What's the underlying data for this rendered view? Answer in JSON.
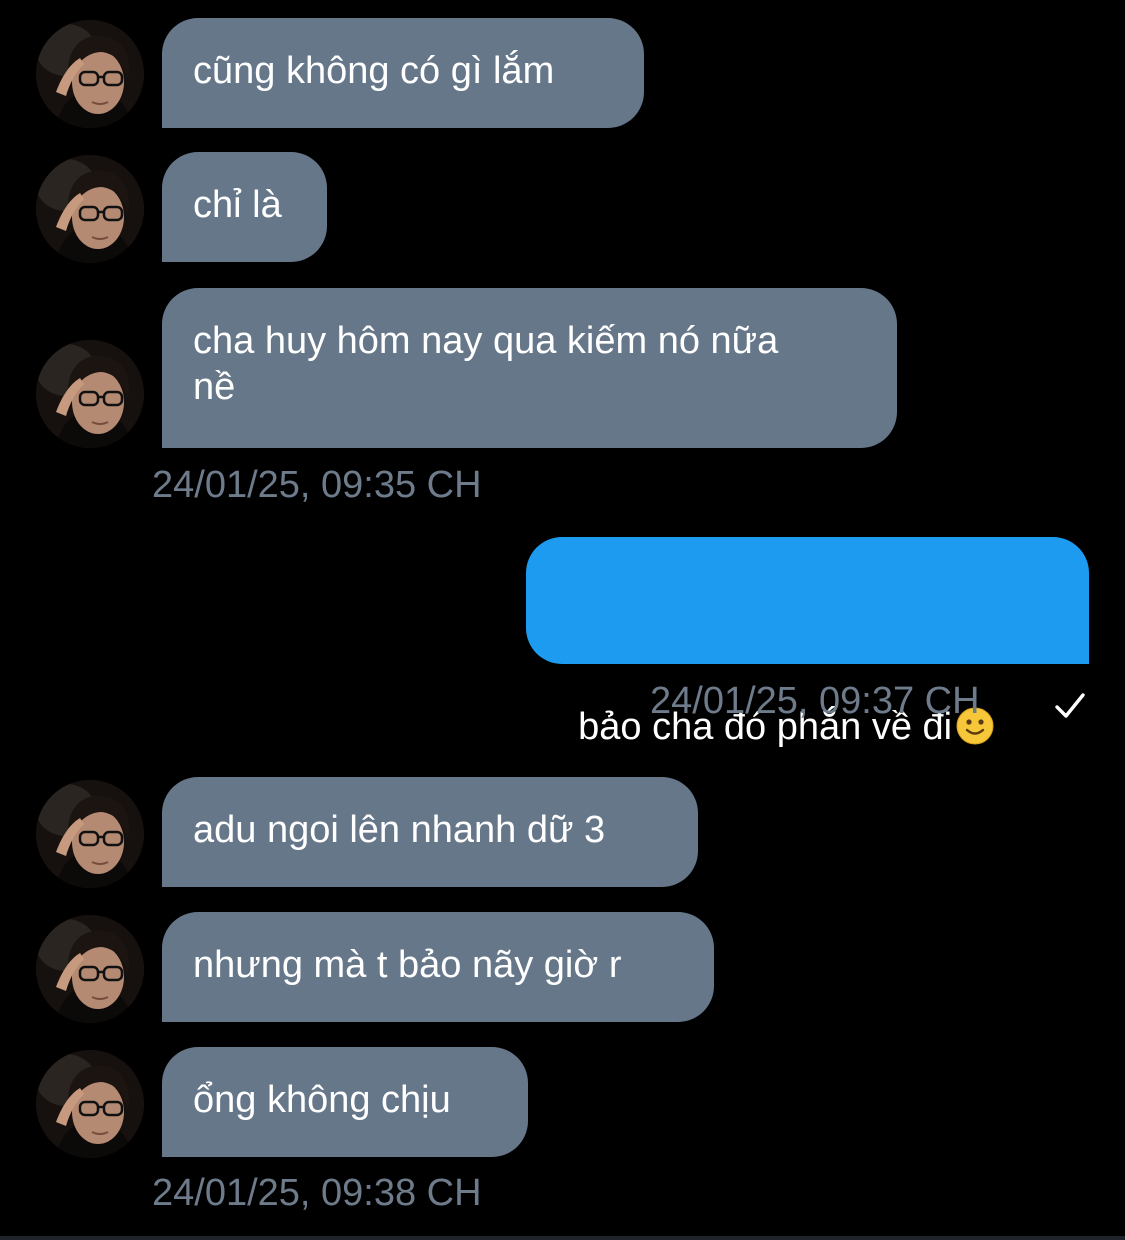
{
  "chat": {
    "incoming_avatar_icon": "user-avatar-photo",
    "read_receipt_icon": "checkmark-icon",
    "emoji_icon": "slightly-smiling-face-emoji",
    "colors": {
      "background": "#000000",
      "incoming_bubble": "#66778a",
      "outgoing_bubble": "#1d9bf0",
      "timestamp": "#6e7b8a"
    },
    "messages": [
      {
        "id": "m1",
        "direction": "in",
        "text": "cũng không có gì lắm"
      },
      {
        "id": "m2",
        "direction": "in",
        "text": "chỉ là"
      },
      {
        "id": "m3",
        "direction": "in",
        "text": "cha huy hôm nay qua kiếm nó nữa\nnề"
      },
      {
        "id": "t1",
        "timestamp": "24/01/25, 09:35 CH"
      },
      {
        "id": "m4",
        "direction": "out",
        "text": "bảo cha đó phắn về đi"
      },
      {
        "id": "t2",
        "timestamp": "24/01/25, 09:37 CH",
        "read": true
      },
      {
        "id": "m5",
        "direction": "in",
        "text": "adu ngoi lên nhanh dữ 3"
      },
      {
        "id": "m6",
        "direction": "in",
        "text": "nhưng mà t bảo nãy giờ r"
      },
      {
        "id": "m7",
        "direction": "in",
        "text": "ổng không chịu"
      },
      {
        "id": "t3",
        "timestamp": "24/01/25, 09:38 CH"
      }
    ]
  }
}
